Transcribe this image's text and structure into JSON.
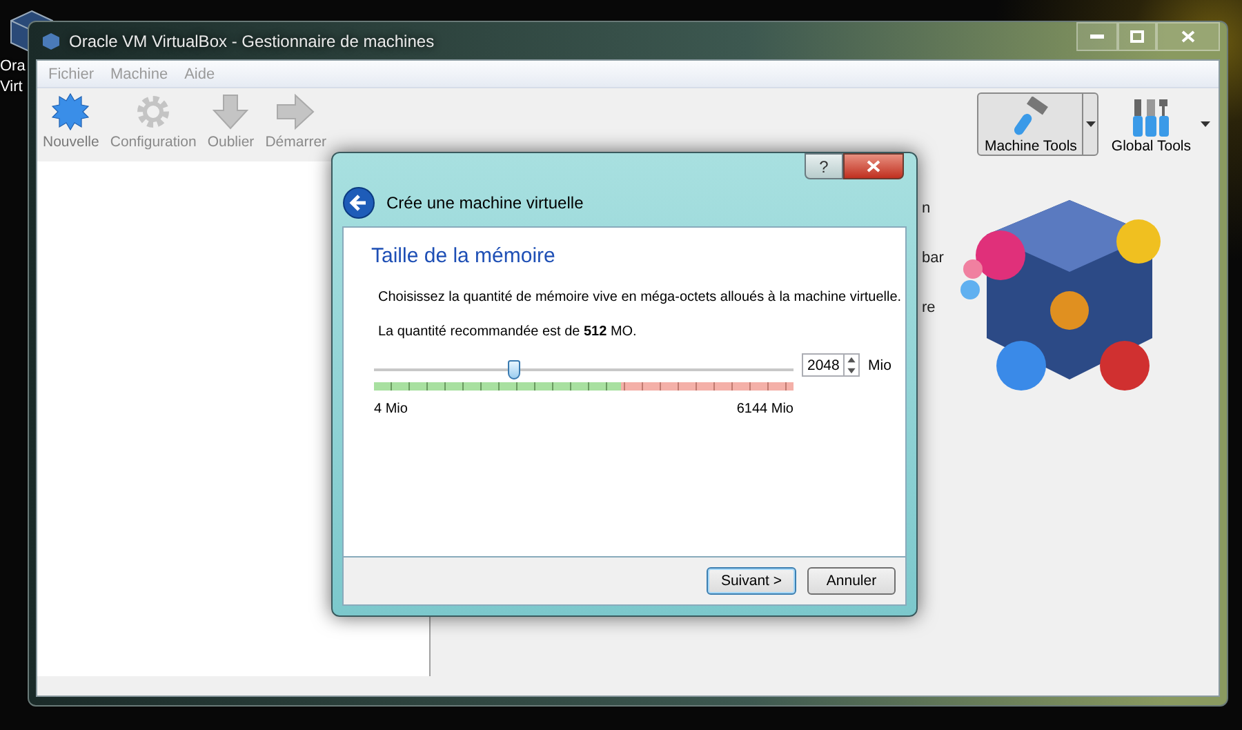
{
  "desktop": {
    "icon_label_lines": [
      "Ora",
      "Virt"
    ]
  },
  "window": {
    "title": "Oracle VM VirtualBox - Gestionnaire de machines"
  },
  "menu": [
    {
      "label": "Fichier",
      "disabled": true
    },
    {
      "label": "Machine",
      "disabled": true
    },
    {
      "label": "Aide",
      "disabled": true
    }
  ],
  "toolbar": [
    {
      "label": "Nouvelle",
      "kind": "new",
      "disabled": false
    },
    {
      "label": "Configuration",
      "kind": "settings",
      "disabled": true
    },
    {
      "label": "Oublier",
      "kind": "discard",
      "disabled": true
    },
    {
      "label": "Démarrer",
      "kind": "start",
      "disabled": true
    }
  ],
  "tools": [
    {
      "label": "Machine Tools",
      "kind": "machine",
      "selected": true
    },
    {
      "label": "Global Tools",
      "kind": "global",
      "selected": false
    }
  ],
  "welcome_fragments": [
    "n",
    "bar",
    "re"
  ],
  "dialog": {
    "help": "?",
    "title": "Crée une machine virtuelle",
    "heading": "Taille de la mémoire",
    "description": "Choisissez la quantité de mémoire vive en méga-octets alloués à la machine virtuelle.",
    "recommendation": "La quantité recommandée est de **512** MO.",
    "slider": {
      "level": 0.333,
      "safe_zone": {
        "level": 0.59
      },
      "min_label": "4 Mio",
      "max_label": "6144 Mio"
    },
    "value": "2048",
    "unit": "Mio",
    "buttons": [
      {
        "label": "Suivant >",
        "kind": "default"
      },
      {
        "label": "Annuler",
        "kind": "normal"
      }
    ]
  }
}
